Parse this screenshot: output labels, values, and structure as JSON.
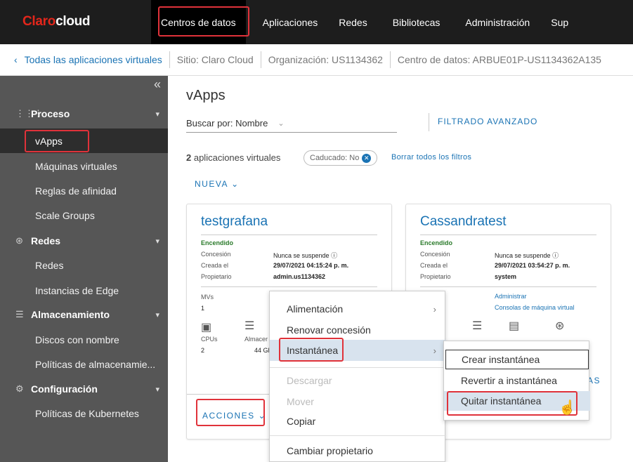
{
  "header": {
    "logo": {
      "part1": "Claro",
      "part2": "cloud"
    },
    "nav": [
      "Centros de datos",
      "Aplicaciones",
      "Redes",
      "Bibliotecas",
      "Administración",
      "Sup"
    ]
  },
  "breadcrumb": {
    "back": "Todas las aplicaciones virtuales",
    "site": "Sitio: Claro Cloud",
    "org": "Organización: US1134362",
    "dc": "Centro de datos: ARBUE01P-US1134362A135"
  },
  "sidebar": {
    "collapse": "«",
    "sections": [
      {
        "label": "Proceso",
        "items": [
          "vApps",
          "Máquinas virtuales",
          "Reglas de afinidad",
          "Scale Groups"
        ]
      },
      {
        "label": "Redes",
        "items": [
          "Redes",
          "Instancias de Edge"
        ]
      },
      {
        "label": "Almacenamiento",
        "items": [
          "Discos con nombre",
          "Políticas de almacenamie..."
        ]
      },
      {
        "label": "Configuración",
        "items": [
          "Políticas de Kubernetes"
        ]
      }
    ]
  },
  "main": {
    "title": "vApps",
    "search_label": "Buscar por: Nombre",
    "advanced_filter": "FILTRADO AVANZADO",
    "count_num": "2",
    "count_text": " aplicaciones virtuales",
    "pill": "Caducado: No",
    "clear_filters": "Borrar todos los filtros",
    "new_button": "NUEVA",
    "cards": [
      {
        "title": "testgrafana",
        "status": "Encendido",
        "lease_label": "Concesión",
        "lease_value": "Nunca se suspende",
        "created_label": "Creada el",
        "created_value": "29/07/2021 04:15:24 p. m.",
        "owner_label": "Propietario",
        "owner_value": "admin.us1134362",
        "vms_label": "MVs",
        "vms_value": "1",
        "cpu_label": "CPUs",
        "cpu_value": "2",
        "storage_label": "Almacer",
        "storage_value": "44 GB (",
        "actions": "ACCIONES"
      },
      {
        "title": "Cassandratest",
        "status": "Encendido",
        "lease_label": "Concesión",
        "lease_value": "Nunca se suspende",
        "created_label": "Creada el",
        "created_value": "29/07/2021 03:54:27 p. m.",
        "owner_label": "Propietario",
        "owner_value": "system",
        "admin_link": "Administrar",
        "consoles_link": "Consolas de máquina virtual",
        "partial_link": "AS"
      }
    ]
  },
  "context_menu": {
    "items": [
      "Alimentación",
      "Renovar concesión",
      "Instantánea",
      "Descargar",
      "Mover",
      "Copiar",
      "Cambiar propietario"
    ]
  },
  "snapshot_menu": {
    "items": [
      "Crear instantánea",
      "Revertir a instantánea",
      "Quitar instantánea"
    ]
  }
}
